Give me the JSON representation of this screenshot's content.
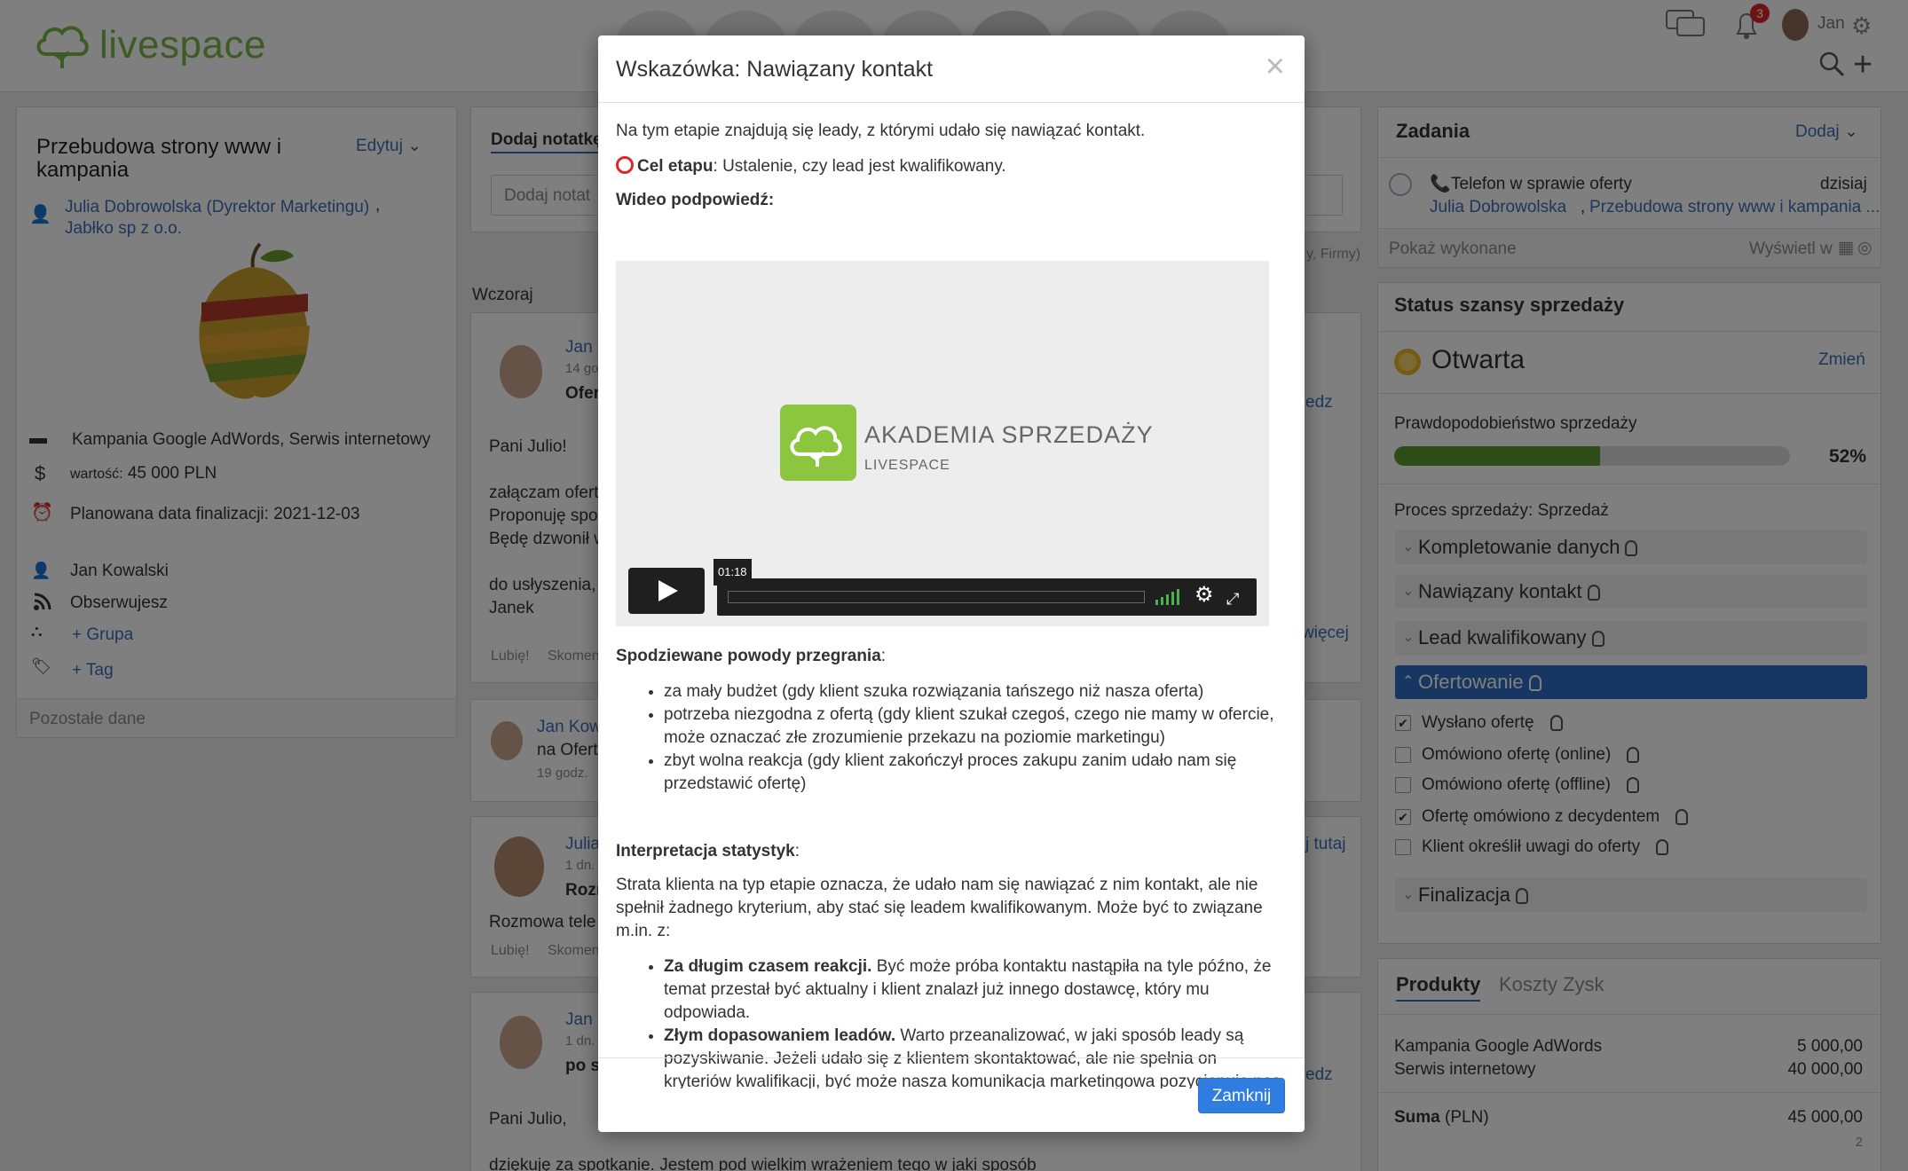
{
  "header": {
    "logo_text": "livespace",
    "user_name": "Jan",
    "notifications_count": "3"
  },
  "deal": {
    "title": "Przebudowa strony www i kampania",
    "edit_label": "Edytuj",
    "contact_person": "Julia Dobrowolska (Dyrektor Marketingu)",
    "company": "Jabłko sp z o.o.",
    "products": "Kampania Google AdWords, Serwis internetowy",
    "value_label": "wartość:",
    "value": "45 000 PLN",
    "finalization": "Planowana data finalizacji: 2021-12-03",
    "owner": "Jan Kowalski",
    "watching": "Obserwujesz",
    "group_link": "+ Grupa",
    "tag_link": "+ Tag",
    "other_data": "Pozostałe dane"
  },
  "feed": {
    "add_note_tab": "Dodaj notatkę",
    "note_placeholder": "Dodaj notat",
    "filter_suffix": "y, Firmy)",
    "day_label": "Wczoraj",
    "post1": {
      "author": "Jan",
      "time": "14 go",
      "subject": "Ofer",
      "more": "edz",
      "body": [
        "Pani Julio!",
        "",
        "załączam ofert",
        "Proponuję spo",
        "Będę dzwonił w",
        "",
        "do usłyszenia,",
        "Janek"
      ],
      "more_link": "więcej",
      "like": "Lubię!",
      "comment": "Skomen"
    },
    "post2": {
      "author": "Jan Kow",
      "line": "na Ofert",
      "time": "19 godz."
    },
    "post3": {
      "author": "Julia",
      "time": "1 dn.",
      "subject": "Rozm",
      "link": "j tutaj",
      "body": "Rozmowa tele",
      "like": "Lubię!",
      "comment": "Skomen"
    },
    "post4": {
      "author": "Jan",
      "time": "1 dn.",
      "subject": "po s",
      "more": "edz",
      "body1": "Pani Julio,",
      "body2": "dziękuję za spotkanie. Jestem pod wielkim wrażeniem tego w jaki sposób"
    }
  },
  "tasks": {
    "title": "Zadania",
    "add_label": "Dodaj",
    "task_title": "Telefon w sprawie oferty",
    "task_due": "dzisiaj",
    "task_person": "Julia Dobrowolska",
    "task_deal": "Przebudowa strony www i kampania ...",
    "show_done": "Pokaż wykonane",
    "show_in": "Wyświetl w"
  },
  "status": {
    "title": "Status szansy sprzedaży",
    "state": "Otwarta",
    "change_label": "Zmień",
    "probability_label": "Prawdopodobieństwo sprzedaży",
    "probability_value": "52%",
    "probability": 0.52,
    "process_label": "Proces sprzedaży: Sprzedaż",
    "stages": [
      "Kompletowanie danych",
      "Nawiązany kontakt",
      "Lead kwalifikowany",
      "Ofertowanie",
      "Finalizacja"
    ],
    "checks": [
      {
        "label": "Wysłano ofertę",
        "checked": true
      },
      {
        "label": "Omówiono ofertę (online)",
        "checked": false
      },
      {
        "label": "Omówiono ofertę (offline)",
        "checked": false
      },
      {
        "label": "Ofertę omówiono z decydentem",
        "checked": true
      },
      {
        "label": "Klient określił uwagi do oferty",
        "checked": false
      }
    ]
  },
  "products": {
    "tabs": [
      "Produkty",
      "Koszty",
      "Zysk"
    ],
    "items": [
      {
        "name": "Kampania Google AdWords",
        "amount": "5 000,00"
      },
      {
        "name": "Serwis internetowy",
        "amount": "40 000,00"
      }
    ],
    "sum_label": "Suma",
    "sum_currency": "(PLN)",
    "sum_value": "45 000,00",
    "count": "2"
  },
  "modal": {
    "title": "Wskazówka: Nawiązany kontakt",
    "intro": "Na tym etapie znajdują się leady, z którymi udało się nawiązać kontakt.",
    "goal_label": "Cel etapu",
    "goal_text": ": Ustalenie, czy lead jest kwalifikowany.",
    "video_label": "Wideo podpowiedź:",
    "video_title": "AKADEMIA SPRZEDAŻY",
    "video_sub": "LIVESPACE",
    "video_time": "01:18",
    "loss_heading": "Spodziewane powody przegrania",
    "loss_reasons": [
      "za mały budżet (gdy klient szuka rozwiązania tańszego niż nasza oferta)",
      "potrzeba niezgodna z ofertą (gdy klient szukał czegoś, czego nie mamy w ofercie, może oznaczać złe zrozumienie przekazu na poziomie marketingu)",
      "zbyt wolna reakcja (gdy klient zakończył proces zakupu zanim udało nam się przedstawić ofertę)"
    ],
    "stats_heading": "Interpretacja statystyk",
    "stats_text": "Strata klienta na typ etapie oznacza, że udało nam się nawiązać z nim kontakt, ale nie spełnił żadnego kryterium, aby stać się leadem kwalifikowanym. Może być to związane m.in. z:",
    "stats_items": [
      {
        "bold": "Za długim czasem reakcji.",
        "text": " Być może próba kontaktu nastąpiła na tyle późno, że temat przestał być aktualny i klient znalazł już innego dostawcę, który mu odpowiada."
      },
      {
        "bold": "Złym dopasowaniem leadów.",
        "text": " Warto przeanalizować, w jaki sposób leady są pozyskiwanie. Jeżeli udało się z klientem skontaktować, ale nie spełnia on kryteriów kwalifikacji, być może nasza komunikacja marketingowa pozycjonuje nas"
      }
    ],
    "close_label": "Zamknij"
  },
  "colors": {
    "accent": "#3b6fb6",
    "brand_green": "#7ab648",
    "active_stage": "#2f6fc5",
    "primary_button": "#2f7de1",
    "progress": "#5c9b2c",
    "status_open": "#e8b82a"
  }
}
